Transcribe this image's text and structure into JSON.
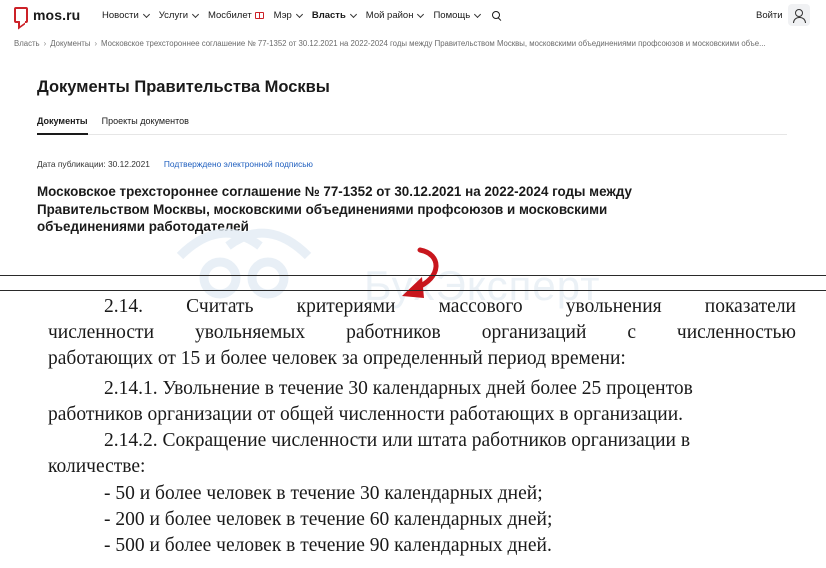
{
  "header": {
    "logo_text": "mos.ru",
    "nav": [
      {
        "label": "Новости",
        "chevron": true
      },
      {
        "label": "Услуги",
        "chevron": true
      },
      {
        "label": "Мосбилет",
        "chevron": false,
        "icon": "ticket-icon"
      },
      {
        "label": "Мэр",
        "chevron": true
      },
      {
        "label": "Власть",
        "chevron": true,
        "bold": true
      },
      {
        "label": "Мой район",
        "chevron": true
      },
      {
        "label": "Помощь",
        "chevron": true
      }
    ],
    "login_label": "Войти",
    "accent_color": "#cc2128"
  },
  "breadcrumb": [
    "Власть",
    "Документы",
    "Московское трехстороннее соглашение № 77-1352 от 30.12.2021 на 2022-2024 годы между Правительством Москвы, московскими объединениями профсоюзов и московскими объе..."
  ],
  "page": {
    "title": "Документы Правительства Москвы",
    "tabs": [
      {
        "label": "Документы",
        "active": true
      },
      {
        "label": "Проекты документов",
        "active": false
      }
    ],
    "publication_date": "Дата публикации: 30.12.2021",
    "signed_link": "Подтверждено электронной подписью",
    "document_title": "Московское трехстороннее соглашение № 77-1352 от 30.12.2021 на 2022-2024 годы между Правительством Москвы, московскими объединениями профсоюзов и московскими объединениями работодателей"
  },
  "watermark_text": "БухЭксперт",
  "excerpt": {
    "line1_words": [
      "2.14.",
      "Считать",
      "критериями",
      "массового",
      "увольнения",
      "показатели"
    ],
    "line2_words": [
      "численности",
      "увольняемых",
      "работников",
      "организаций",
      "с",
      "численностью"
    ],
    "line3": "работающих от 15 и более человек за определенный период времени:",
    "line4": "2.14.1. Увольнение в течение 30 календарных дней более 25 процентов",
    "line5": "работников организации от общей численности работающих в организации.",
    "line6": "2.14.2. Сокращение численности или штата работников организации в",
    "line7": "количестве:",
    "line8": "- 50 и более человек в течение 30 календарных дней;",
    "line9": "- 200 и более человек в течение 60 календарных дней;",
    "line10": "- 500 и более человек в течение 90 календарных дней."
  }
}
